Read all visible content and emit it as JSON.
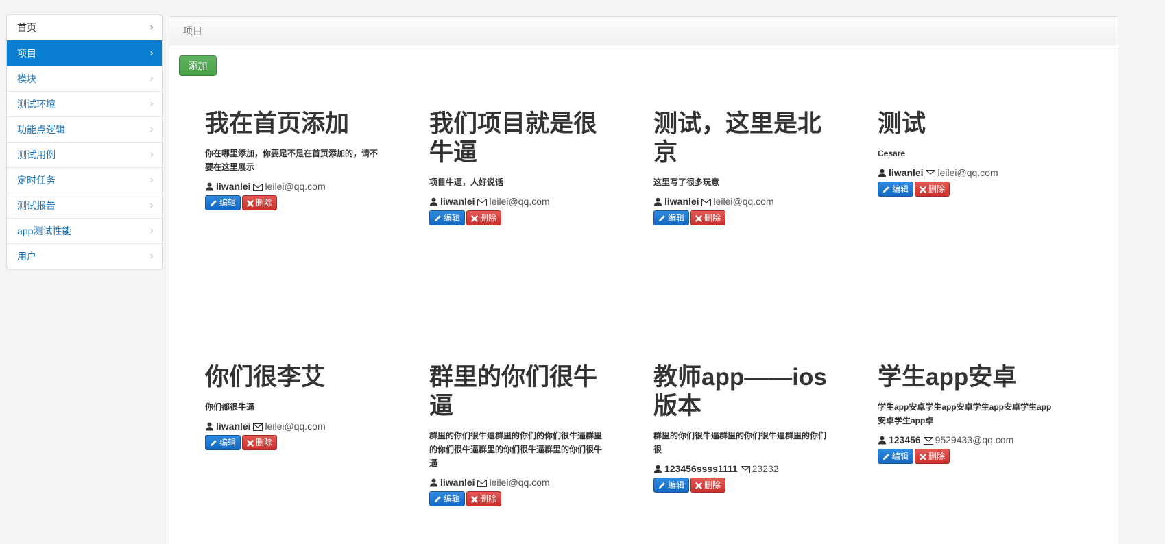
{
  "sidebar": {
    "items": [
      {
        "label": "首页"
      },
      {
        "label": "项目"
      },
      {
        "label": "模块"
      },
      {
        "label": "测试环境"
      },
      {
        "label": "功能点逻辑"
      },
      {
        "label": "测试用例"
      },
      {
        "label": "定时任务"
      },
      {
        "label": "测试报告"
      },
      {
        "label": "app测试性能"
      },
      {
        "label": "用户"
      }
    ],
    "active_index": 1
  },
  "panel": {
    "title": "项目",
    "add_label": "添加"
  },
  "actions": {
    "edit_label": "编辑",
    "delete_label": "删除"
  },
  "projects": [
    {
      "title": "我在首页添加",
      "desc": "你在哪里添加，你要是不是在首页添加的，请不要在这里展示",
      "user": "liwanlei",
      "email": "leilei@qq.com"
    },
    {
      "title": "我们项目就是很牛逼",
      "desc": "项目牛逼，人好说话",
      "user": "liwanlei",
      "email": "leilei@qq.com"
    },
    {
      "title": "测试，这里是北京",
      "desc": "这里写了很多玩意",
      "user": "liwanlei",
      "email": "leilei@qq.com"
    },
    {
      "title": "测试",
      "desc": "Cesare",
      "user": "liwanlei",
      "email": "leilei@qq.com"
    },
    {
      "title": "你们很李艾",
      "desc": "你们都很牛逼",
      "user": "liwanlei",
      "email": "leilei@qq.com"
    },
    {
      "title": "群里的你们很牛逼",
      "desc": "群里的你们很牛逼群里的你们的你们很牛逼群里的你们很牛逼群里的你们很牛逼群里的你们很牛逼",
      "user": "liwanlei",
      "email": "leilei@qq.com"
    },
    {
      "title": "教师app——ios版本",
      "desc": "群里的你们很牛逼群里的你们很牛逼群里的你们很",
      "user": "123456ssss1111",
      "email": "23232"
    },
    {
      "title": "学生app安卓",
      "desc": "学生app安卓学生app安卓学生app安卓学生app安卓学生app卓",
      "user": "123456",
      "email": "9529433@qq.com"
    }
  ]
}
